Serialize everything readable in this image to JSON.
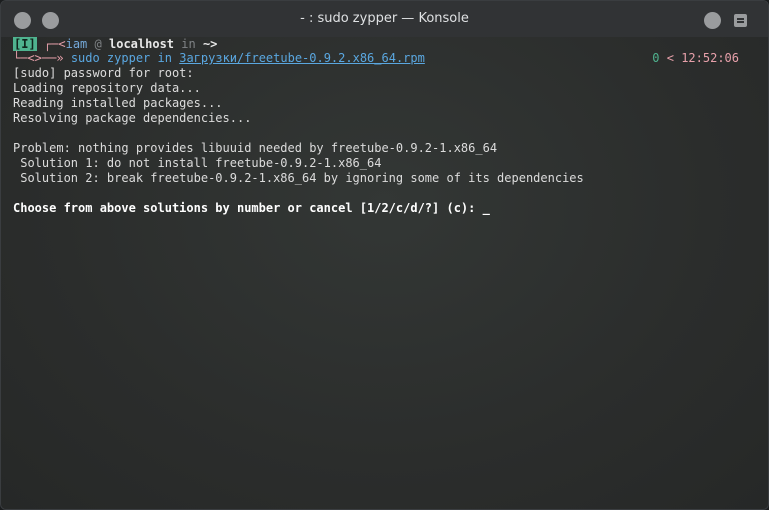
{
  "window": {
    "title": "- : sudo zypper — Konsole"
  },
  "prompt": {
    "mode_tag": "[I]",
    "corner_top": "┌─",
    "user_lt": "<",
    "user": "iam",
    "at": "@",
    "host": "localhost",
    "in": "in",
    "cwd": "~>",
    "corner_bottom": "└─<>──»",
    "cmd_sudo": "sudo zypper",
    "cmd_in": "in",
    "path": "Загрузки/freetube-0.9.2.x86_64.rpm",
    "status_code": "0",
    "status_sep": " < ",
    "time": "12:52:06"
  },
  "output": {
    "lines": [
      "[sudo] password for root:",
      "Loading repository data...",
      "Reading installed packages...",
      "Resolving package dependencies...",
      "",
      "Problem: nothing provides libuuid needed by freetube-0.9.2-1.x86_64",
      " Solution 1: do not install freetube-0.9.2-1.x86_64",
      " Solution 2: break freetube-0.9.2-1.x86_64 by ignoring some of its dependencies",
      ""
    ],
    "question": "Choose from above solutions by number or cancel [1/2/c/d/?] (c): ",
    "cursor": "_"
  },
  "colors": {
    "accent_green": "#4fb38f",
    "pink": "#e7a0aa",
    "blue": "#5aa7e0"
  }
}
